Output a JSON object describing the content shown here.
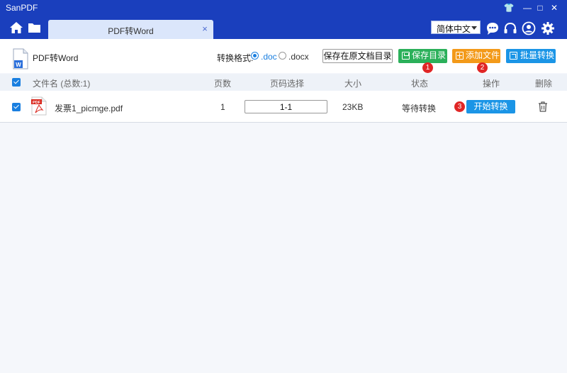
{
  "app": {
    "title": "SanPDF",
    "window_controls": {
      "skin": "👕",
      "minimize": "—",
      "maximize": "□",
      "close": "✕"
    }
  },
  "nav": {
    "tab_label": "PDF转Word",
    "tab_close": "×",
    "language": "简体中文"
  },
  "toolbar": {
    "page_title": "PDF转Word",
    "format_label": "转换格式:",
    "formats": [
      {
        "label": ".doc",
        "checked": true
      },
      {
        "label": ".docx",
        "checked": false
      }
    ],
    "save_original_label": "保存在原文档目录",
    "save_dir_label": "保存目录",
    "add_file_label": "添加文件",
    "batch_label": "批量转换",
    "badges": [
      "1",
      "2",
      "3"
    ]
  },
  "table": {
    "headers": {
      "file_name": "文件名 (总数:1)",
      "pages": "页数",
      "page_select": "页码选择",
      "size": "大小",
      "status": "状态",
      "action": "操作",
      "delete": "删除"
    },
    "rows": [
      {
        "file_name": "发票1_picmge.pdf",
        "pages": "1",
        "page_range": "1-1",
        "size": "23KB",
        "status": "等待转换",
        "action_label": "开始转换",
        "icon_text": "PDF"
      }
    ]
  },
  "colors": {
    "brand_blue": "#1a3fbd",
    "save_green": "#2bb05a",
    "add_orange": "#f39a1a",
    "action_blue": "#1b95e6",
    "badge_red": "#e02626"
  }
}
